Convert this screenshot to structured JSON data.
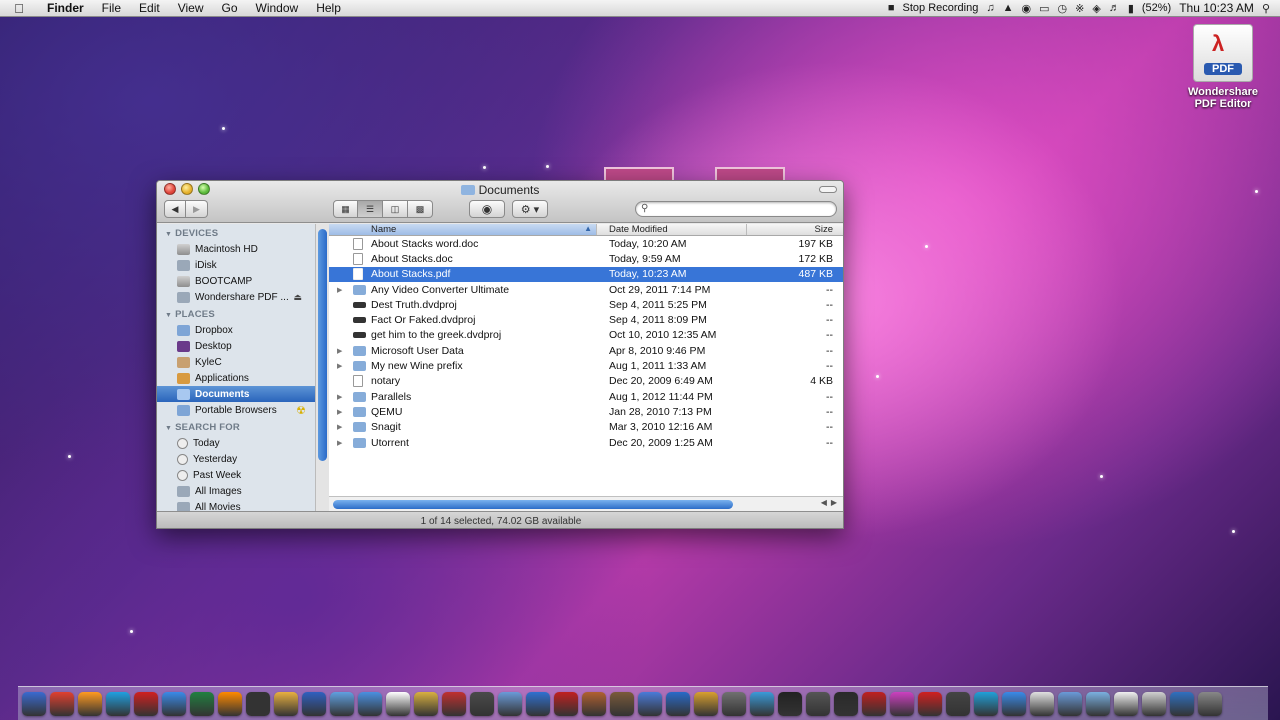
{
  "menubar": {
    "apple": "",
    "app": "Finder",
    "menus": [
      "File",
      "Edit",
      "View",
      "Go",
      "Window",
      "Help"
    ],
    "stop_recording": "Stop Recording",
    "battery": "(52%)",
    "clock": "Thu 10:23 AM"
  },
  "desktop_icon": {
    "badge": "PDF",
    "label_line1": "Wondershare",
    "label_line2": "PDF Editor"
  },
  "window": {
    "title": "Documents",
    "status": "1 of 14 selected, 74.02 GB available"
  },
  "sidebar": {
    "devices_header": "DEVICES",
    "devices": [
      "Macintosh HD",
      "iDisk",
      "BOOTCAMP",
      "Wondershare PDF ..."
    ],
    "places_header": "PLACES",
    "places": [
      "Dropbox",
      "Desktop",
      "KyleC",
      "Applications",
      "Documents",
      "Portable Browsers"
    ],
    "search_header": "SEARCH FOR",
    "search_for": [
      "Today",
      "Yesterday",
      "Past Week",
      "All Images",
      "All Movies"
    ]
  },
  "list": {
    "headers": {
      "name": "Name",
      "date": "Date Modified",
      "size": "Size"
    },
    "rows": [
      {
        "name": "About Stacks word.doc",
        "date": "Today, 10:20 AM",
        "size": "197 KB",
        "kind": "doc"
      },
      {
        "name": "About Stacks.doc",
        "date": "Today, 9:59 AM",
        "size": "172 KB",
        "kind": "doc"
      },
      {
        "name": "About Stacks.pdf",
        "date": "Today, 10:23 AM",
        "size": "487 KB",
        "kind": "doc"
      },
      {
        "name": "Any Video Converter Ultimate",
        "date": "Oct 29, 2011 7:14 PM",
        "size": "--",
        "kind": "folder"
      },
      {
        "name": "Dest Truth.dvdproj",
        "date": "Sep 4, 2011 5:25 PM",
        "size": "--",
        "kind": "dvd"
      },
      {
        "name": "Fact Or Faked.dvdproj",
        "date": "Sep 4, 2011 8:09 PM",
        "size": "--",
        "kind": "dvd"
      },
      {
        "name": "get him to the greek.dvdproj",
        "date": "Oct 10, 2010 12:35 AM",
        "size": "--",
        "kind": "dvd"
      },
      {
        "name": "Microsoft User Data",
        "date": "Apr 8, 2010 9:46 PM",
        "size": "--",
        "kind": "folder"
      },
      {
        "name": "My new Wine prefix",
        "date": "Aug 1, 2011 1:33 AM",
        "size": "--",
        "kind": "folder"
      },
      {
        "name": "notary",
        "date": "Dec 20, 2009 6:49 AM",
        "size": "4 KB",
        "kind": "doc"
      },
      {
        "name": "Parallels",
        "date": "Aug 1, 2012 11:44 PM",
        "size": "--",
        "kind": "folder"
      },
      {
        "name": "QEMU",
        "date": "Jan 28, 2010 7:13 PM",
        "size": "--",
        "kind": "folder"
      },
      {
        "name": "Snagit",
        "date": "Mar 3, 2010 12:16 AM",
        "size": "--",
        "kind": "folder"
      },
      {
        "name": "Utorrent",
        "date": "Dec 20, 2009 1:25 AM",
        "size": "--",
        "kind": "folder"
      }
    ],
    "selected_row": "About Stacks.pdf"
  },
  "colors": {
    "selection": "#3875d7",
    "sidebar_bg": "#dde4eb",
    "dock_icons": [
      "#3a6ad0",
      "#e04030",
      "#ff9a20",
      "#20a0e0",
      "#d02020",
      "#3a8ae8",
      "#208040",
      "#ff8a00",
      "#333",
      "#e8b040",
      "#3060c0",
      "#60a0e0",
      "#4a90e0",
      "#ffffff",
      "#d8b040",
      "#c03030",
      "#4a4a4a",
      "#6a9ad8",
      "#3070d0",
      "#c02020",
      "#b06030",
      "#7a5a3a",
      "#4a7ad8",
      "#2a6ac8",
      "#d8a030",
      "#707070",
      "#3a9ad8",
      "#222",
      "#555",
      "#2a2a2a",
      "#c02020",
      "#cc40c0",
      "#d02020",
      "#444",
      "#20a0d8",
      "#3a8ae8",
      "#e0e0e0",
      "#6a9ad8",
      "#7ab0e0",
      "#f0f0f0",
      "#d0d0d0",
      "#3070c0",
      "#888"
    ]
  }
}
